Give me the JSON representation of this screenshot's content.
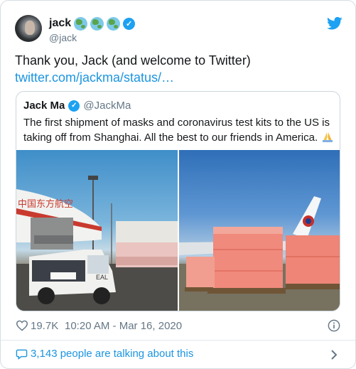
{
  "author": {
    "name": "jack",
    "handle": "@jack",
    "name_emojis": [
      "globe-africa-europe-icon",
      "globe-americas-icon",
      "globe-asia-australia-icon"
    ],
    "verified": true
  },
  "tweet": {
    "text": "Thank you, Jack (and welcome to Twitter)",
    "link": "twitter.com/jackma/status/…"
  },
  "quoted_tweet": {
    "name": "Jack Ma",
    "handle": "@JackMa",
    "verified": true,
    "text": "The first shipment of masks and coronavirus test kits to the US is taking off from Shanghai. All the best to our friends in America.",
    "emoji": "folded-hands-icon",
    "photos": [
      "cargo-plane-loading-photo",
      "cargo-pallets-photo"
    ]
  },
  "meta": {
    "likes": "19.7K",
    "timestamp": "10:20 AM - Mar 16, 2020"
  },
  "conversation": {
    "label": "3,143 people are talking about this"
  },
  "colors": {
    "link": "#1b95e0",
    "twitter_blue": "#1da1f2",
    "muted": "#657786",
    "border": "#ccd6dd"
  }
}
